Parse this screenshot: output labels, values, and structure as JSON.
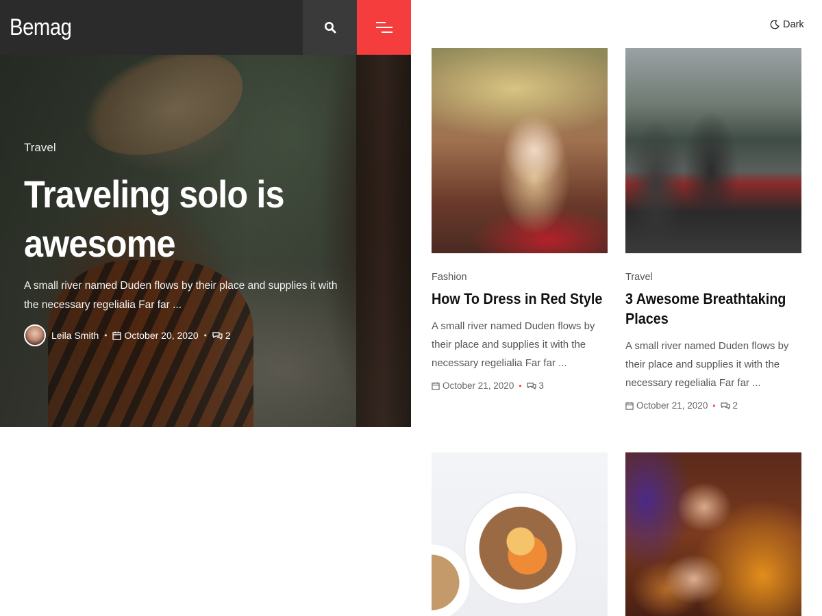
{
  "header": {
    "brand": "Bemag",
    "search_icon": "search-icon",
    "menu_icon": "menu-icon",
    "dark_label": "Dark",
    "dark_icon": "moon-icon",
    "accent_color": "#f53d3d"
  },
  "hero": {
    "category": "Travel",
    "title": "Traveling solo is awesome",
    "excerpt": "A small river named Duden flows by their place and supplies it with the necessary regelialia Far far ...",
    "author": "Leila Smith",
    "date": "October 20, 2020",
    "comments": "2"
  },
  "cards": [
    {
      "category": "Fashion",
      "title": "How To Dress in Red Style",
      "excerpt": "A small river named Duden flows by their place and supplies it with the necessary regelialia Far far ...",
      "date": "October 21, 2020",
      "comments": "3"
    },
    {
      "category": "Travel",
      "title": "3 Awesome Breathtaking Places",
      "excerpt": "A small river named Duden flows by their place and supplies it with the necessary regelialia Far far ...",
      "date": "October 21, 2020",
      "comments": "2"
    },
    {},
    {}
  ]
}
